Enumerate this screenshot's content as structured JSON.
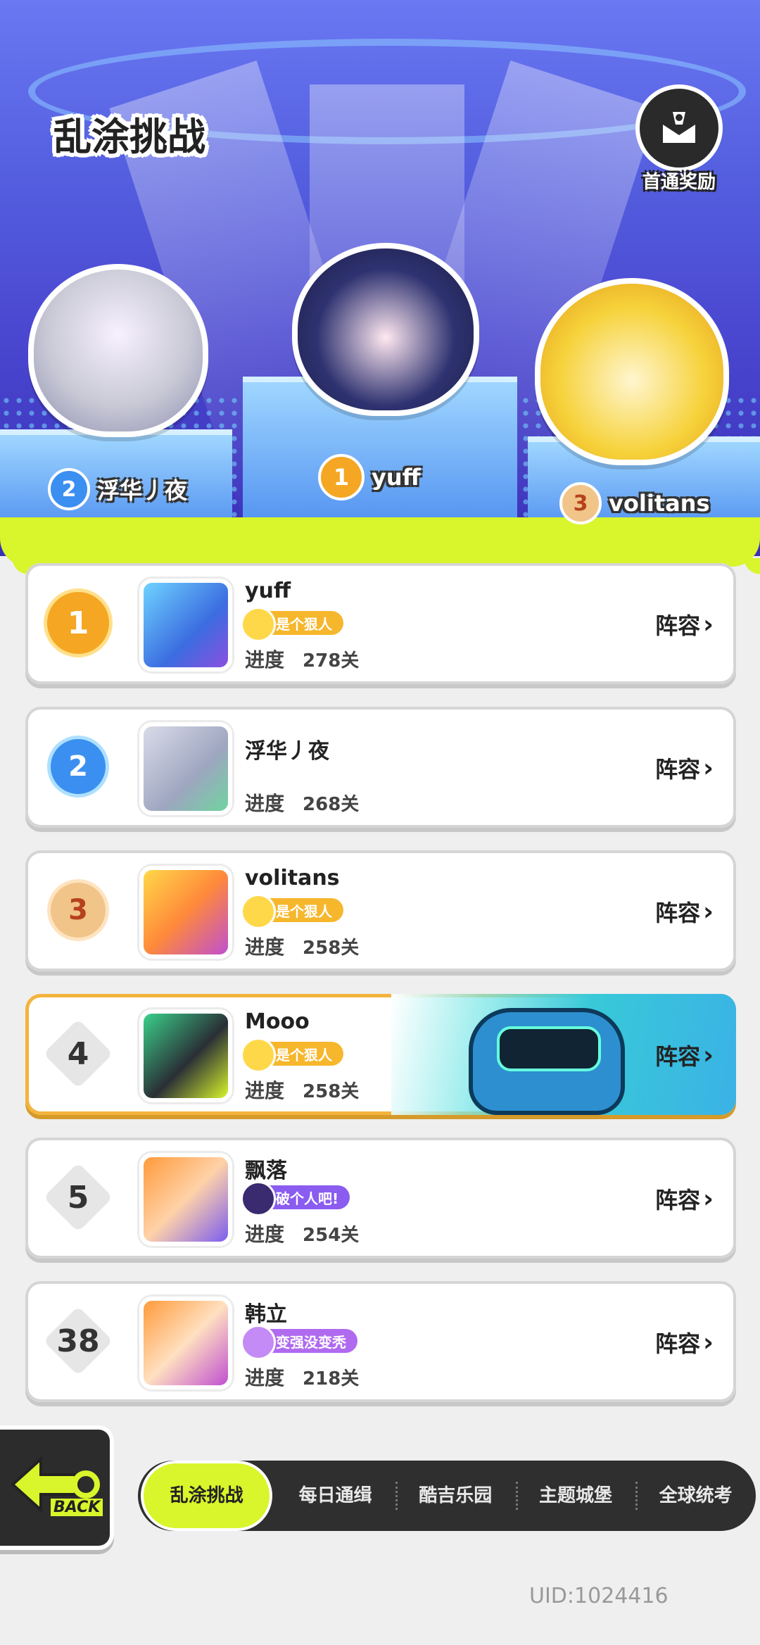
{
  "page_title": "乱涂挑战",
  "first_clear_reward": {
    "label": "首通奖励",
    "icon": "first-clear-reward-icon"
  },
  "podium": [
    {
      "rank": "2",
      "name": "浮华丿夜"
    },
    {
      "rank": "1",
      "name": "yuff"
    },
    {
      "rank": "3",
      "name": "volitans"
    }
  ],
  "progress_label": "进度",
  "lineup_label": "阵容",
  "leaderboard": [
    {
      "rank": "1",
      "name": "yuff",
      "title": "是个狠人",
      "progress": "278关"
    },
    {
      "rank": "2",
      "name": "浮华丿夜",
      "title": "",
      "progress": "268关"
    },
    {
      "rank": "3",
      "name": "volitans",
      "title": "是个狠人",
      "progress": "258关"
    },
    {
      "rank": "4",
      "name": "Mooo",
      "title": "是个狠人",
      "progress": "258关"
    },
    {
      "rank": "5",
      "name": "飘落",
      "title": "破个人吧!",
      "progress": "254关"
    },
    {
      "rank": "38",
      "name": "韩立",
      "title": "变强没变秃",
      "progress": "218关"
    }
  ],
  "back_button": {
    "label": "BACK"
  },
  "tabs": [
    {
      "label": "乱涂挑战",
      "active": true
    },
    {
      "label": "每日通缉",
      "active": false
    },
    {
      "label": "酷吉乐园",
      "active": false
    },
    {
      "label": "主题城堡",
      "active": false
    },
    {
      "label": "全球统考",
      "active": false
    }
  ],
  "uid": "UID:1024416",
  "colors": {
    "accent_lime": "#d9f52b",
    "gold": "#f5a623",
    "self_border": "#f3b33d"
  }
}
